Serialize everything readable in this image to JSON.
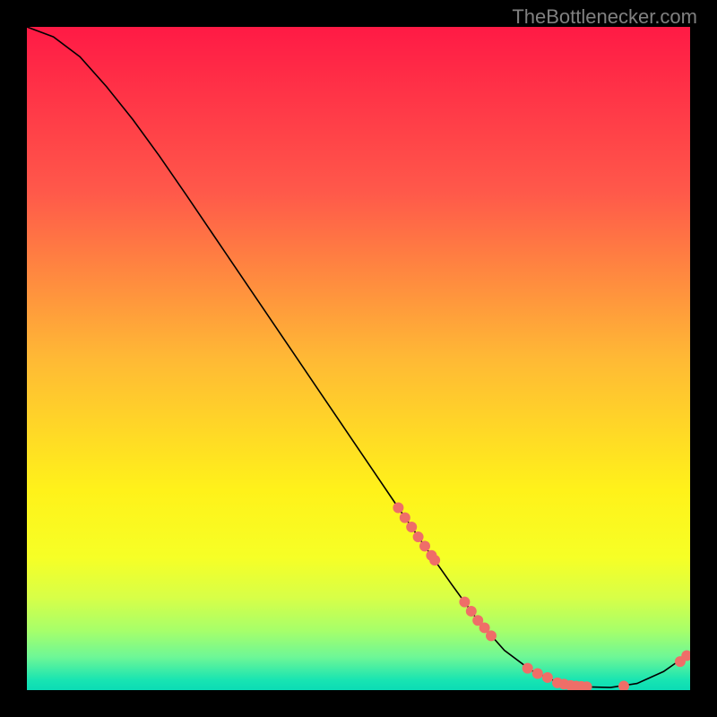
{
  "attribution": "TheBottlenecker.com",
  "chart_data": {
    "type": "line",
    "title": "",
    "xlabel": "",
    "ylabel": "",
    "xlim": [
      0,
      1
    ],
    "ylim": [
      0,
      100
    ],
    "gradient_stops": [
      {
        "offset": 0.0,
        "color": "#ff1a45"
      },
      {
        "offset": 0.25,
        "color": "#ff594a"
      },
      {
        "offset": 0.5,
        "color": "#ffb935"
      },
      {
        "offset": 0.7,
        "color": "#fff21a"
      },
      {
        "offset": 0.8,
        "color": "#f6ff26"
      },
      {
        "offset": 0.86,
        "color": "#d8ff47"
      },
      {
        "offset": 0.91,
        "color": "#a7ff6a"
      },
      {
        "offset": 0.95,
        "color": "#6ef796"
      },
      {
        "offset": 0.985,
        "color": "#18e4b2"
      },
      {
        "offset": 1.0,
        "color": "#0bdcb5"
      }
    ],
    "series": [
      {
        "name": "bottleneck-curve",
        "type": "line",
        "x": [
          0.0,
          0.04,
          0.08,
          0.12,
          0.16,
          0.2,
          0.24,
          0.28,
          0.32,
          0.36,
          0.4,
          0.44,
          0.48,
          0.52,
          0.56,
          0.6,
          0.64,
          0.68,
          0.72,
          0.76,
          0.8,
          0.84,
          0.88,
          0.92,
          0.96,
          1.0
        ],
        "y": [
          100.0,
          98.5,
          95.5,
          91.0,
          86.0,
          80.5,
          74.7,
          68.8,
          62.9,
          57.0,
          51.1,
          45.2,
          39.3,
          33.4,
          27.5,
          21.7,
          16.0,
          10.5,
          6.0,
          3.0,
          1.2,
          0.5,
          0.4,
          1.0,
          2.8,
          5.6
        ]
      },
      {
        "name": "match-dots",
        "type": "scatter",
        "x": [
          0.56,
          0.57,
          0.58,
          0.59,
          0.6,
          0.61,
          0.615,
          0.66,
          0.67,
          0.68,
          0.69,
          0.7,
          0.755,
          0.77,
          0.785,
          0.8,
          0.81,
          0.82,
          0.828,
          0.836,
          0.844,
          0.9,
          0.985,
          0.995
        ],
        "y": [
          27.5,
          26.0,
          24.6,
          23.1,
          21.7,
          20.3,
          19.6,
          13.3,
          11.9,
          10.5,
          9.4,
          8.2,
          3.3,
          2.5,
          1.9,
          1.1,
          0.9,
          0.7,
          0.6,
          0.55,
          0.5,
          0.6,
          4.3,
          5.2
        ]
      }
    ]
  }
}
